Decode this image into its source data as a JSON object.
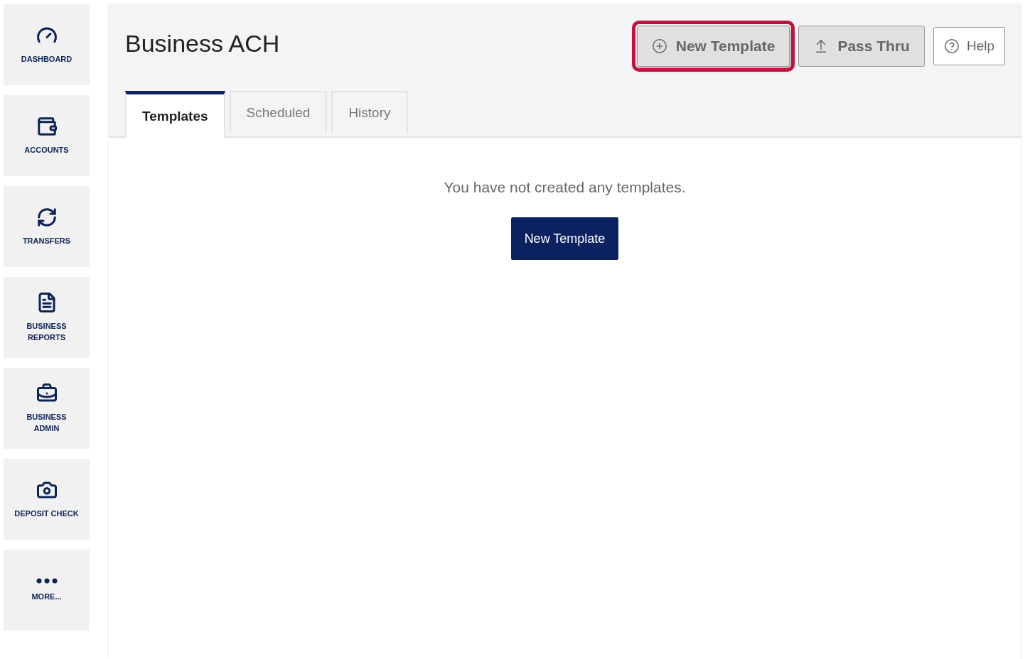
{
  "sidebar": {
    "items": [
      {
        "label": "DASHBOARD"
      },
      {
        "label": "ACCOUNTS"
      },
      {
        "label": "TRANSFERS"
      },
      {
        "label": "BUSINESS REPORTS"
      },
      {
        "label": "BUSINESS ADMIN"
      },
      {
        "label": "DEPOSIT CHECK"
      },
      {
        "label": "MORE..."
      }
    ]
  },
  "header": {
    "title": "Business ACH",
    "buttons": [
      {
        "label": "New Template",
        "kind": "grey",
        "highlighted": true
      },
      {
        "label": "Pass Thru",
        "kind": "grey",
        "highlighted": false
      },
      {
        "label": "Help",
        "kind": "white",
        "highlighted": false
      }
    ]
  },
  "tabs": [
    {
      "label": "Templates",
      "selected": true
    },
    {
      "label": "Scheduled",
      "selected": false
    },
    {
      "label": "History",
      "selected": false
    }
  ],
  "empty_state": {
    "message": "You have not created any templates.",
    "button": "New Template"
  }
}
